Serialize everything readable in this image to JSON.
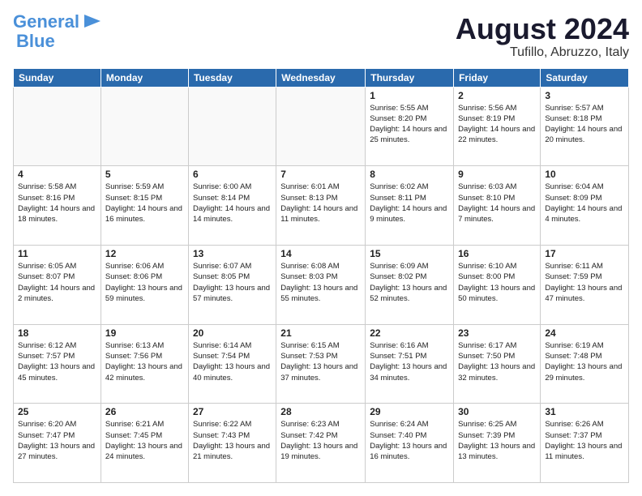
{
  "header": {
    "logo_line1": "General",
    "logo_line2": "Blue",
    "month_title": "August 2024",
    "location": "Tufillo, Abruzzo, Italy"
  },
  "days_of_week": [
    "Sunday",
    "Monday",
    "Tuesday",
    "Wednesday",
    "Thursday",
    "Friday",
    "Saturday"
  ],
  "weeks": [
    [
      {
        "day": "",
        "info": ""
      },
      {
        "day": "",
        "info": ""
      },
      {
        "day": "",
        "info": ""
      },
      {
        "day": "",
        "info": ""
      },
      {
        "day": "1",
        "info": "Sunrise: 5:55 AM\nSunset: 8:20 PM\nDaylight: 14 hours\nand 25 minutes."
      },
      {
        "day": "2",
        "info": "Sunrise: 5:56 AM\nSunset: 8:19 PM\nDaylight: 14 hours\nand 22 minutes."
      },
      {
        "day": "3",
        "info": "Sunrise: 5:57 AM\nSunset: 8:18 PM\nDaylight: 14 hours\nand 20 minutes."
      }
    ],
    [
      {
        "day": "4",
        "info": "Sunrise: 5:58 AM\nSunset: 8:16 PM\nDaylight: 14 hours\nand 18 minutes."
      },
      {
        "day": "5",
        "info": "Sunrise: 5:59 AM\nSunset: 8:15 PM\nDaylight: 14 hours\nand 16 minutes."
      },
      {
        "day": "6",
        "info": "Sunrise: 6:00 AM\nSunset: 8:14 PM\nDaylight: 14 hours\nand 14 minutes."
      },
      {
        "day": "7",
        "info": "Sunrise: 6:01 AM\nSunset: 8:13 PM\nDaylight: 14 hours\nand 11 minutes."
      },
      {
        "day": "8",
        "info": "Sunrise: 6:02 AM\nSunset: 8:11 PM\nDaylight: 14 hours\nand 9 minutes."
      },
      {
        "day": "9",
        "info": "Sunrise: 6:03 AM\nSunset: 8:10 PM\nDaylight: 14 hours\nand 7 minutes."
      },
      {
        "day": "10",
        "info": "Sunrise: 6:04 AM\nSunset: 8:09 PM\nDaylight: 14 hours\nand 4 minutes."
      }
    ],
    [
      {
        "day": "11",
        "info": "Sunrise: 6:05 AM\nSunset: 8:07 PM\nDaylight: 14 hours\nand 2 minutes."
      },
      {
        "day": "12",
        "info": "Sunrise: 6:06 AM\nSunset: 8:06 PM\nDaylight: 13 hours\nand 59 minutes."
      },
      {
        "day": "13",
        "info": "Sunrise: 6:07 AM\nSunset: 8:05 PM\nDaylight: 13 hours\nand 57 minutes."
      },
      {
        "day": "14",
        "info": "Sunrise: 6:08 AM\nSunset: 8:03 PM\nDaylight: 13 hours\nand 55 minutes."
      },
      {
        "day": "15",
        "info": "Sunrise: 6:09 AM\nSunset: 8:02 PM\nDaylight: 13 hours\nand 52 minutes."
      },
      {
        "day": "16",
        "info": "Sunrise: 6:10 AM\nSunset: 8:00 PM\nDaylight: 13 hours\nand 50 minutes."
      },
      {
        "day": "17",
        "info": "Sunrise: 6:11 AM\nSunset: 7:59 PM\nDaylight: 13 hours\nand 47 minutes."
      }
    ],
    [
      {
        "day": "18",
        "info": "Sunrise: 6:12 AM\nSunset: 7:57 PM\nDaylight: 13 hours\nand 45 minutes."
      },
      {
        "day": "19",
        "info": "Sunrise: 6:13 AM\nSunset: 7:56 PM\nDaylight: 13 hours\nand 42 minutes."
      },
      {
        "day": "20",
        "info": "Sunrise: 6:14 AM\nSunset: 7:54 PM\nDaylight: 13 hours\nand 40 minutes."
      },
      {
        "day": "21",
        "info": "Sunrise: 6:15 AM\nSunset: 7:53 PM\nDaylight: 13 hours\nand 37 minutes."
      },
      {
        "day": "22",
        "info": "Sunrise: 6:16 AM\nSunset: 7:51 PM\nDaylight: 13 hours\nand 34 minutes."
      },
      {
        "day": "23",
        "info": "Sunrise: 6:17 AM\nSunset: 7:50 PM\nDaylight: 13 hours\nand 32 minutes."
      },
      {
        "day": "24",
        "info": "Sunrise: 6:19 AM\nSunset: 7:48 PM\nDaylight: 13 hours\nand 29 minutes."
      }
    ],
    [
      {
        "day": "25",
        "info": "Sunrise: 6:20 AM\nSunset: 7:47 PM\nDaylight: 13 hours\nand 27 minutes."
      },
      {
        "day": "26",
        "info": "Sunrise: 6:21 AM\nSunset: 7:45 PM\nDaylight: 13 hours\nand 24 minutes."
      },
      {
        "day": "27",
        "info": "Sunrise: 6:22 AM\nSunset: 7:43 PM\nDaylight: 13 hours\nand 21 minutes."
      },
      {
        "day": "28",
        "info": "Sunrise: 6:23 AM\nSunset: 7:42 PM\nDaylight: 13 hours\nand 19 minutes."
      },
      {
        "day": "29",
        "info": "Sunrise: 6:24 AM\nSunset: 7:40 PM\nDaylight: 13 hours\nand 16 minutes."
      },
      {
        "day": "30",
        "info": "Sunrise: 6:25 AM\nSunset: 7:39 PM\nDaylight: 13 hours\nand 13 minutes."
      },
      {
        "day": "31",
        "info": "Sunrise: 6:26 AM\nSunset: 7:37 PM\nDaylight: 13 hours\nand 11 minutes."
      }
    ]
  ]
}
